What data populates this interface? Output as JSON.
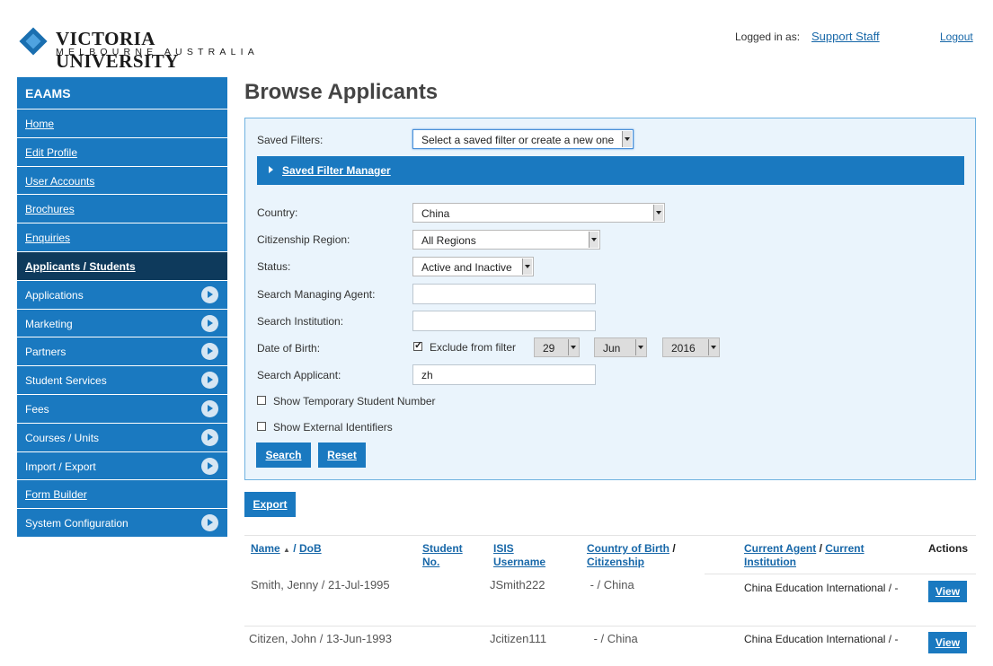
{
  "header": {
    "logo_name": "VICTORIA UNIVERSITY",
    "logo_sub": "MELBOURNE AUSTRALIA",
    "logged_in_label": "Logged in as:",
    "user": "Support Staff",
    "logout": "Logout"
  },
  "sidebar": {
    "title": "EAAMS",
    "items": [
      {
        "label": "Home",
        "icon": ""
      },
      {
        "label": "Edit Profile",
        "icon": ""
      },
      {
        "label": "User Accounts",
        "icon": ""
      },
      {
        "label": "Brochures",
        "icon": ""
      },
      {
        "label": "Enquiries",
        "icon": ""
      },
      {
        "label": "Applicants / Students",
        "icon": ""
      },
      {
        "label": "Applications",
        "icon": "expand-arrow-icon"
      },
      {
        "label": "Marketing",
        "icon": "expand-arrow-icon"
      },
      {
        "label": "Partners",
        "icon": "expand-arrow-icon"
      },
      {
        "label": "Student Services",
        "icon": "expand-arrow-icon"
      },
      {
        "label": "Fees",
        "icon": "expand-arrow-icon"
      },
      {
        "label": "Courses / Units",
        "icon": "expand-arrow-icon"
      },
      {
        "label": "Import / Export",
        "icon": "expand-arrow-icon"
      },
      {
        "label": "Form Builder",
        "icon": ""
      },
      {
        "label": "System Configuration",
        "icon": "expand-arrow-icon"
      }
    ]
  },
  "page": {
    "title": "Browse Applicants"
  },
  "filters": {
    "saved_filters_label": "Saved Filters:",
    "saved_filters_value": "Select a saved filter or create a new one",
    "saved_filter_manager": "Saved Filter Manager",
    "country_label": "Country:",
    "country_value": "China",
    "region_label": "Citizenship Region:",
    "region_value": "All Regions",
    "status_label": "Status:",
    "status_value": "Active and Inactive",
    "agent_label": "Search Managing Agent:",
    "agent_value": "",
    "institution_label": "Search Institution:",
    "institution_value": "",
    "dob_label": "Date of Birth:",
    "dob_exclude_label": "Exclude from filter",
    "dob_exclude_checked": true,
    "dob_day": "29",
    "dob_month": "Jun",
    "dob_year": "2016",
    "applicant_label": "Search Applicant:",
    "applicant_value": "zh",
    "temp_number_label": "Show Temporary Student Number",
    "external_ids_label": "Show External Identifiers",
    "search_button": "Search",
    "reset_button": "Reset"
  },
  "export_button": "Export",
  "table": {
    "headers": {
      "name": "Name",
      "name_sort": "▲",
      "name_sep": "/",
      "dob": "DoB",
      "student_no_1": "Student",
      "student_no_2": "No.",
      "isis_1": "ISIS",
      "isis_2": "Username",
      "country_birth": "Country of Birth",
      "country_sep": "/",
      "citizenship": "Citizenship",
      "current_agent": "Current Agent",
      "agent_sep": "/",
      "current_1": "Current",
      "institution": "Institution",
      "actions": "Actions"
    },
    "rows": [
      {
        "name_dob": "Smith, Jenny / 21-Jul-1995",
        "student_no": "",
        "isis": "JSmith222",
        "country": " - / China",
        "agent": "China Education International / -",
        "action": "View"
      },
      {
        "name_dob": "Citizen, John / 13-Jun-1993",
        "student_no": "",
        "isis": "Jcitizen111",
        "country": " - / China",
        "agent": "China Education International / -",
        "action": "View"
      }
    ]
  }
}
